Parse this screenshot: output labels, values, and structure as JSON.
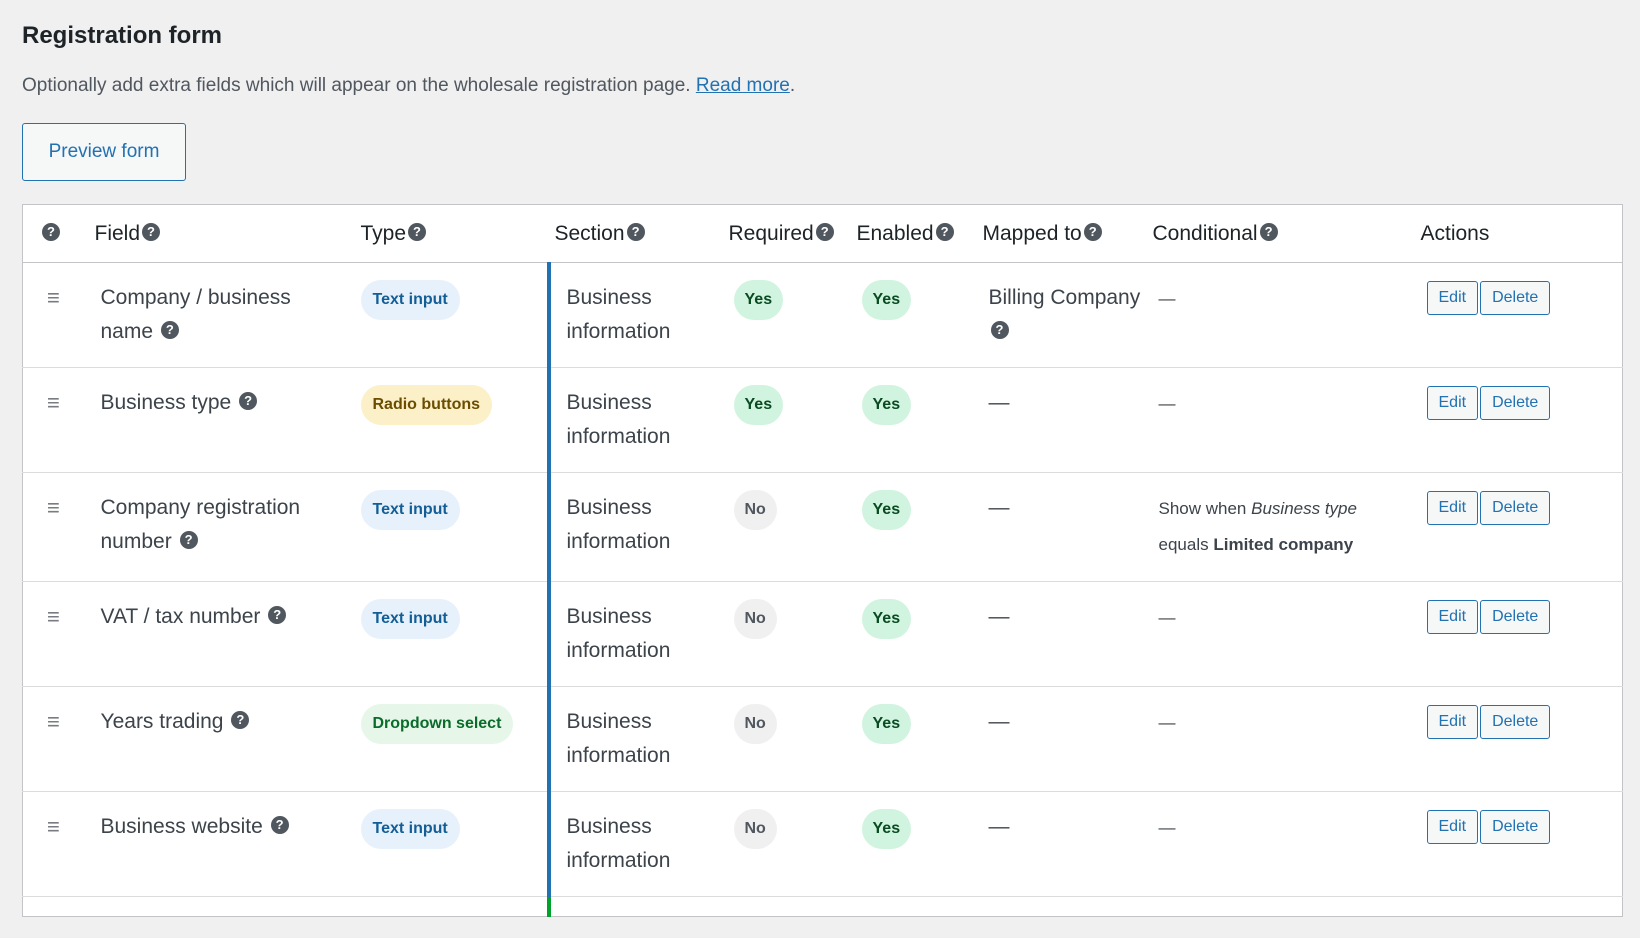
{
  "page": {
    "title": "Registration form",
    "description": "Optionally add extra fields which will appear on the wholesale registration page.",
    "read_more": "Read more",
    "period": ".",
    "preview_button": "Preview form"
  },
  "table": {
    "headers": {
      "help": "?",
      "field": "Field",
      "type": "Type",
      "section": "Section",
      "required": "Required",
      "enabled": "Enabled",
      "mapped_to": "Mapped to",
      "conditional": "Conditional",
      "actions": "Actions"
    },
    "edit_label": "Edit",
    "delete_label": "Delete",
    "rows": [
      {
        "field": "Company / business name",
        "type": "Text input",
        "type_style": "text",
        "section": "Business information",
        "required": "Yes",
        "enabled": "Yes",
        "mapped_to": "Billing Company",
        "conditional": "—"
      },
      {
        "field": "Business type",
        "type": "Radio buttons",
        "type_style": "radio",
        "section": "Business information",
        "required": "Yes",
        "enabled": "Yes",
        "mapped_to": "—",
        "conditional": "—"
      },
      {
        "field": "Company registration number",
        "type": "Text input",
        "type_style": "text",
        "section": "Business information",
        "required": "No",
        "enabled": "Yes",
        "mapped_to": "—",
        "conditional_prefix": "Show when",
        "conditional_field": "Business type",
        "conditional_mid": "equals",
        "conditional_value": "Limited company"
      },
      {
        "field": "VAT / tax number",
        "type": "Text input",
        "type_style": "text",
        "section": "Business information",
        "required": "No",
        "enabled": "Yes",
        "mapped_to": "—",
        "conditional": "—"
      },
      {
        "field": "Years trading",
        "type": "Dropdown select",
        "type_style": "drop",
        "section": "Business information",
        "required": "No",
        "enabled": "Yes",
        "mapped_to": "—",
        "conditional": "—"
      },
      {
        "field": "Business website",
        "type": "Text input",
        "type_style": "text",
        "section": "Business information",
        "required": "No",
        "enabled": "Yes",
        "mapped_to": "—",
        "conditional": "—"
      }
    ]
  },
  "colors": {
    "accent": "#2271b1",
    "section_bar": "#2271b1",
    "section_bar_next": "#00a32a"
  }
}
